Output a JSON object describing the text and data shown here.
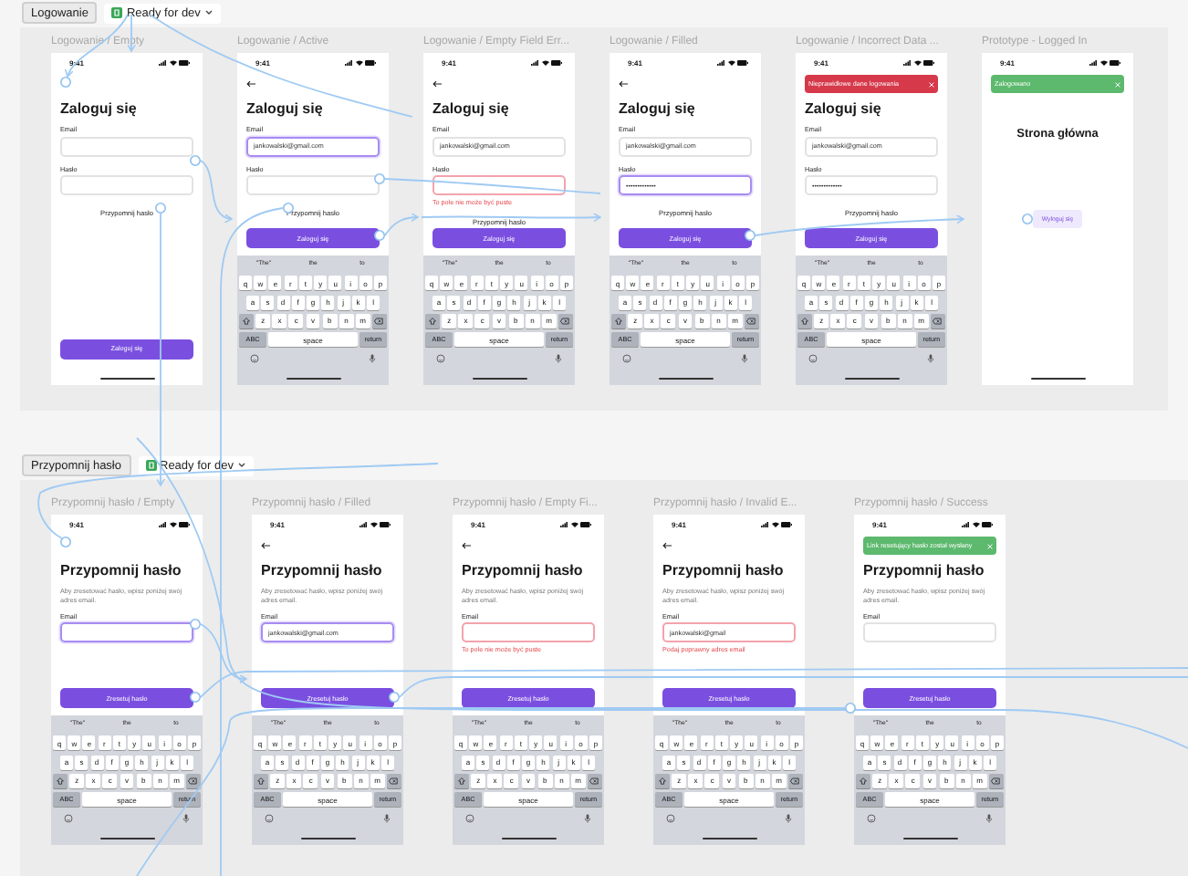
{
  "sections": [
    {
      "name": "Logowanie",
      "status": "Ready for dev",
      "frames": [
        {
          "label": "Logowanie / Empty",
          "screen": {
            "kind": "form",
            "time": "9:41",
            "back": false,
            "title": "Zaloguj się",
            "fields": [
              {
                "label": "Email",
                "focused": false,
                "invalid": false
              },
              {
                "label": "Hasło",
                "focused": false,
                "invalid": false
              }
            ],
            "link": "Przypomnij hasło",
            "button": "Zaloguj się"
          }
        },
        {
          "label": "Logowanie / Active",
          "screen": {
            "kind": "form",
            "time": "9:41",
            "back": true,
            "title": "Zaloguj się",
            "fields": [
              {
                "label": "Email",
                "value": "jankowalski@gmail.com",
                "focused": true,
                "invalid": false
              },
              {
                "label": "Hasło",
                "focused": false,
                "invalid": false
              }
            ],
            "link": "Przypomnij hasło",
            "button": "Zaloguj się",
            "keyboard": {
              "suggestions": [
                "\"The\"",
                "the",
                "to"
              ],
              "rows": [
                [
                  "q",
                  "w",
                  "e",
                  "r",
                  "t",
                  "y",
                  "u",
                  "i",
                  "o",
                  "p"
                ],
                [
                  "a",
                  "s",
                  "d",
                  "f",
                  "g",
                  "h",
                  "j",
                  "k",
                  "l"
                ],
                [
                  "z",
                  "x",
                  "c",
                  "v",
                  "b",
                  "n",
                  "m"
                ]
              ],
              "bottom": [
                "ABC",
                "space",
                "return"
              ]
            }
          }
        },
        {
          "label": "Logowanie / Empty Field Err...",
          "screen": {
            "kind": "form",
            "time": "9:41",
            "back": true,
            "title": "Zaloguj się",
            "fields": [
              {
                "label": "Email",
                "value": "jankowalski@gmail.com",
                "focused": false,
                "invalid": false
              },
              {
                "label": "Hasło",
                "focused": false,
                "invalid": true,
                "error_text": "To pole nie może być puste"
              }
            ],
            "link": "Przypomnij hasło",
            "button": "Zaloguj się",
            "keyboard": {
              "suggestions": [
                "\"The\"",
                "the",
                "to"
              ],
              "rows": [
                [
                  "q",
                  "w",
                  "e",
                  "r",
                  "t",
                  "y",
                  "u",
                  "i",
                  "o",
                  "p"
                ],
                [
                  "a",
                  "s",
                  "d",
                  "f",
                  "g",
                  "h",
                  "j",
                  "k",
                  "l"
                ],
                [
                  "z",
                  "x",
                  "c",
                  "v",
                  "b",
                  "n",
                  "m"
                ]
              ],
              "bottom": [
                "ABC",
                "space",
                "return"
              ]
            }
          }
        },
        {
          "label": "Logowanie / Filled",
          "screen": {
            "kind": "form",
            "time": "9:41",
            "back": true,
            "title": "Zaloguj się",
            "fields": [
              {
                "label": "Email",
                "value": "jankowalski@gmail.com",
                "focused": false,
                "invalid": false
              },
              {
                "label": "Hasło",
                "value": "•••••••••••••",
                "focused": true,
                "invalid": false
              }
            ],
            "link": "Przypomnij hasło",
            "button": "Zaloguj się",
            "keyboard": {
              "suggestions": [
                "\"The\"",
                "the",
                "to"
              ],
              "rows": [
                [
                  "q",
                  "w",
                  "e",
                  "r",
                  "t",
                  "y",
                  "u",
                  "i",
                  "o",
                  "p"
                ],
                [
                  "a",
                  "s",
                  "d",
                  "f",
                  "g",
                  "h",
                  "j",
                  "k",
                  "l"
                ],
                [
                  "z",
                  "x",
                  "c",
                  "v",
                  "b",
                  "n",
                  "m"
                ]
              ],
              "bottom": [
                "ABC",
                "space",
                "return"
              ]
            }
          }
        },
        {
          "label": "Logowanie / Incorrect Data ...",
          "screen": {
            "kind": "form",
            "time": "9:41",
            "back": false,
            "toast": {
              "kind": "error",
              "text": "Nieprawidłowe dane logowania"
            },
            "title": "Zaloguj się",
            "fields": [
              {
                "label": "Email",
                "value": "jankowalski@gmail.com",
                "focused": false,
                "invalid": false
              },
              {
                "label": "Hasło",
                "value": "•••••••••••••",
                "focused": false,
                "invalid": false
              }
            ],
            "link": "Przypomnij hasło",
            "button": "Zaloguj się",
            "keyboard": {
              "suggestions": [
                "\"The\"",
                "the",
                "to"
              ],
              "rows": [
                [
                  "q",
                  "w",
                  "e",
                  "r",
                  "t",
                  "y",
                  "u",
                  "i",
                  "o",
                  "p"
                ],
                [
                  "a",
                  "s",
                  "d",
                  "f",
                  "g",
                  "h",
                  "j",
                  "k",
                  "l"
                ],
                [
                  "z",
                  "x",
                  "c",
                  "v",
                  "b",
                  "n",
                  "m"
                ]
              ],
              "bottom": [
                "ABC",
                "space",
                "return"
              ]
            }
          }
        },
        {
          "label": "Prototype - Logged In",
          "screen": {
            "kind": "home",
            "time": "9:41",
            "toast": {
              "kind": "success",
              "text": "Zalogowano"
            },
            "heading": "Strona główna",
            "button": "Wyloguj się"
          }
        }
      ]
    },
    {
      "name": "Przypomnij hasło",
      "status": "Ready for dev",
      "frames": [
        {
          "label": "Przypomnij hasło / Empty",
          "screen": {
            "kind": "form",
            "time": "9:41",
            "back": false,
            "title": "Przypomnij hasło",
            "subtitle": "Aby zresetować hasło, wpisz poniżej swój adres email.",
            "fields": [
              {
                "label": "Email",
                "focused": true,
                "invalid": false
              }
            ],
            "button": "Zresetuj hasło",
            "keyboard": {
              "suggestions": [
                "\"The\"",
                "the",
                "to"
              ],
              "rows": [
                [
                  "q",
                  "w",
                  "e",
                  "r",
                  "t",
                  "y",
                  "u",
                  "i",
                  "o",
                  "p"
                ],
                [
                  "a",
                  "s",
                  "d",
                  "f",
                  "g",
                  "h",
                  "j",
                  "k",
                  "l"
                ],
                [
                  "z",
                  "x",
                  "c",
                  "v",
                  "b",
                  "n",
                  "m"
                ]
              ],
              "bottom": [
                "ABC",
                "space",
                "return"
              ]
            }
          }
        },
        {
          "label": "Przypomnij hasło / Filled",
          "screen": {
            "kind": "form",
            "time": "9:41",
            "back": true,
            "title": "Przypomnij hasło",
            "subtitle": "Aby zresetować hasło, wpisz poniżej swój adres email.",
            "fields": [
              {
                "label": "Email",
                "value": "jankowalski@gmail.com",
                "focused": true,
                "invalid": false
              }
            ],
            "button": "Zresetuj hasło",
            "keyboard": {
              "suggestions": [
                "\"The\"",
                "the",
                "to"
              ],
              "rows": [
                [
                  "q",
                  "w",
                  "e",
                  "r",
                  "t",
                  "y",
                  "u",
                  "i",
                  "o",
                  "p"
                ],
                [
                  "a",
                  "s",
                  "d",
                  "f",
                  "g",
                  "h",
                  "j",
                  "k",
                  "l"
                ],
                [
                  "z",
                  "x",
                  "c",
                  "v",
                  "b",
                  "n",
                  "m"
                ]
              ],
              "bottom": [
                "ABC",
                "space",
                "return"
              ]
            }
          }
        },
        {
          "label": "Przypomnij hasło / Empty Fi...",
          "screen": {
            "kind": "form",
            "time": "9:41",
            "back": true,
            "title": "Przypomnij hasło",
            "subtitle": "Aby zresetować hasło, wpisz poniżej swój adres email.",
            "fields": [
              {
                "label": "Email",
                "focused": false,
                "invalid": true,
                "error_text": "To pole nie może być puste"
              }
            ],
            "button": "Zresetuj hasło",
            "keyboard": {
              "suggestions": [
                "\"The\"",
                "the",
                "to"
              ],
              "rows": [
                [
                  "q",
                  "w",
                  "e",
                  "r",
                  "t",
                  "y",
                  "u",
                  "i",
                  "o",
                  "p"
                ],
                [
                  "a",
                  "s",
                  "d",
                  "f",
                  "g",
                  "h",
                  "j",
                  "k",
                  "l"
                ],
                [
                  "z",
                  "x",
                  "c",
                  "v",
                  "b",
                  "n",
                  "m"
                ]
              ],
              "bottom": [
                "ABC",
                "space",
                "return"
              ]
            }
          }
        },
        {
          "label": "Przypomnij hasło / Invalid E...",
          "screen": {
            "kind": "form",
            "time": "9:41",
            "back": true,
            "title": "Przypomnij hasło",
            "subtitle": "Aby zresetować hasło, wpisz poniżej swój adres email.",
            "fields": [
              {
                "label": "Email",
                "value": "jankowalski@gmail",
                "focused": false,
                "invalid": true,
                "error_text": "Podaj poprawny adres email"
              }
            ],
            "button": "Zresetuj hasło",
            "keyboard": {
              "suggestions": [
                "\"The\"",
                "the",
                "to"
              ],
              "rows": [
                [
                  "q",
                  "w",
                  "e",
                  "r",
                  "t",
                  "y",
                  "u",
                  "i",
                  "o",
                  "p"
                ],
                [
                  "a",
                  "s",
                  "d",
                  "f",
                  "g",
                  "h",
                  "j",
                  "k",
                  "l"
                ],
                [
                  "z",
                  "x",
                  "c",
                  "v",
                  "b",
                  "n",
                  "m"
                ]
              ],
              "bottom": [
                "ABC",
                "space",
                "return"
              ]
            }
          }
        },
        {
          "label": "Przypomnij hasło / Success",
          "screen": {
            "kind": "form",
            "time": "9:41",
            "back": false,
            "toast": {
              "kind": "success",
              "text": "Link resetujący hasło został wysłany"
            },
            "title": "Przypomnij hasło",
            "subtitle": "Aby zresetować hasło, wpisz poniżej swój adres email.",
            "fields": [
              {
                "label": "Email",
                "focused": false,
                "invalid": false
              }
            ],
            "button": "Zresetuj hasło",
            "keyboard": {
              "suggestions": [
                "\"The\"",
                "the",
                "to"
              ],
              "rows": [
                [
                  "q",
                  "w",
                  "e",
                  "r",
                  "t",
                  "y",
                  "u",
                  "i",
                  "o",
                  "p"
                ],
                [
                  "a",
                  "s",
                  "d",
                  "f",
                  "g",
                  "h",
                  "j",
                  "k",
                  "l"
                ],
                [
                  "z",
                  "x",
                  "c",
                  "v",
                  "b",
                  "n",
                  "m"
                ]
              ],
              "bottom": [
                "ABC",
                "space",
                "return"
              ]
            }
          }
        }
      ]
    }
  ]
}
